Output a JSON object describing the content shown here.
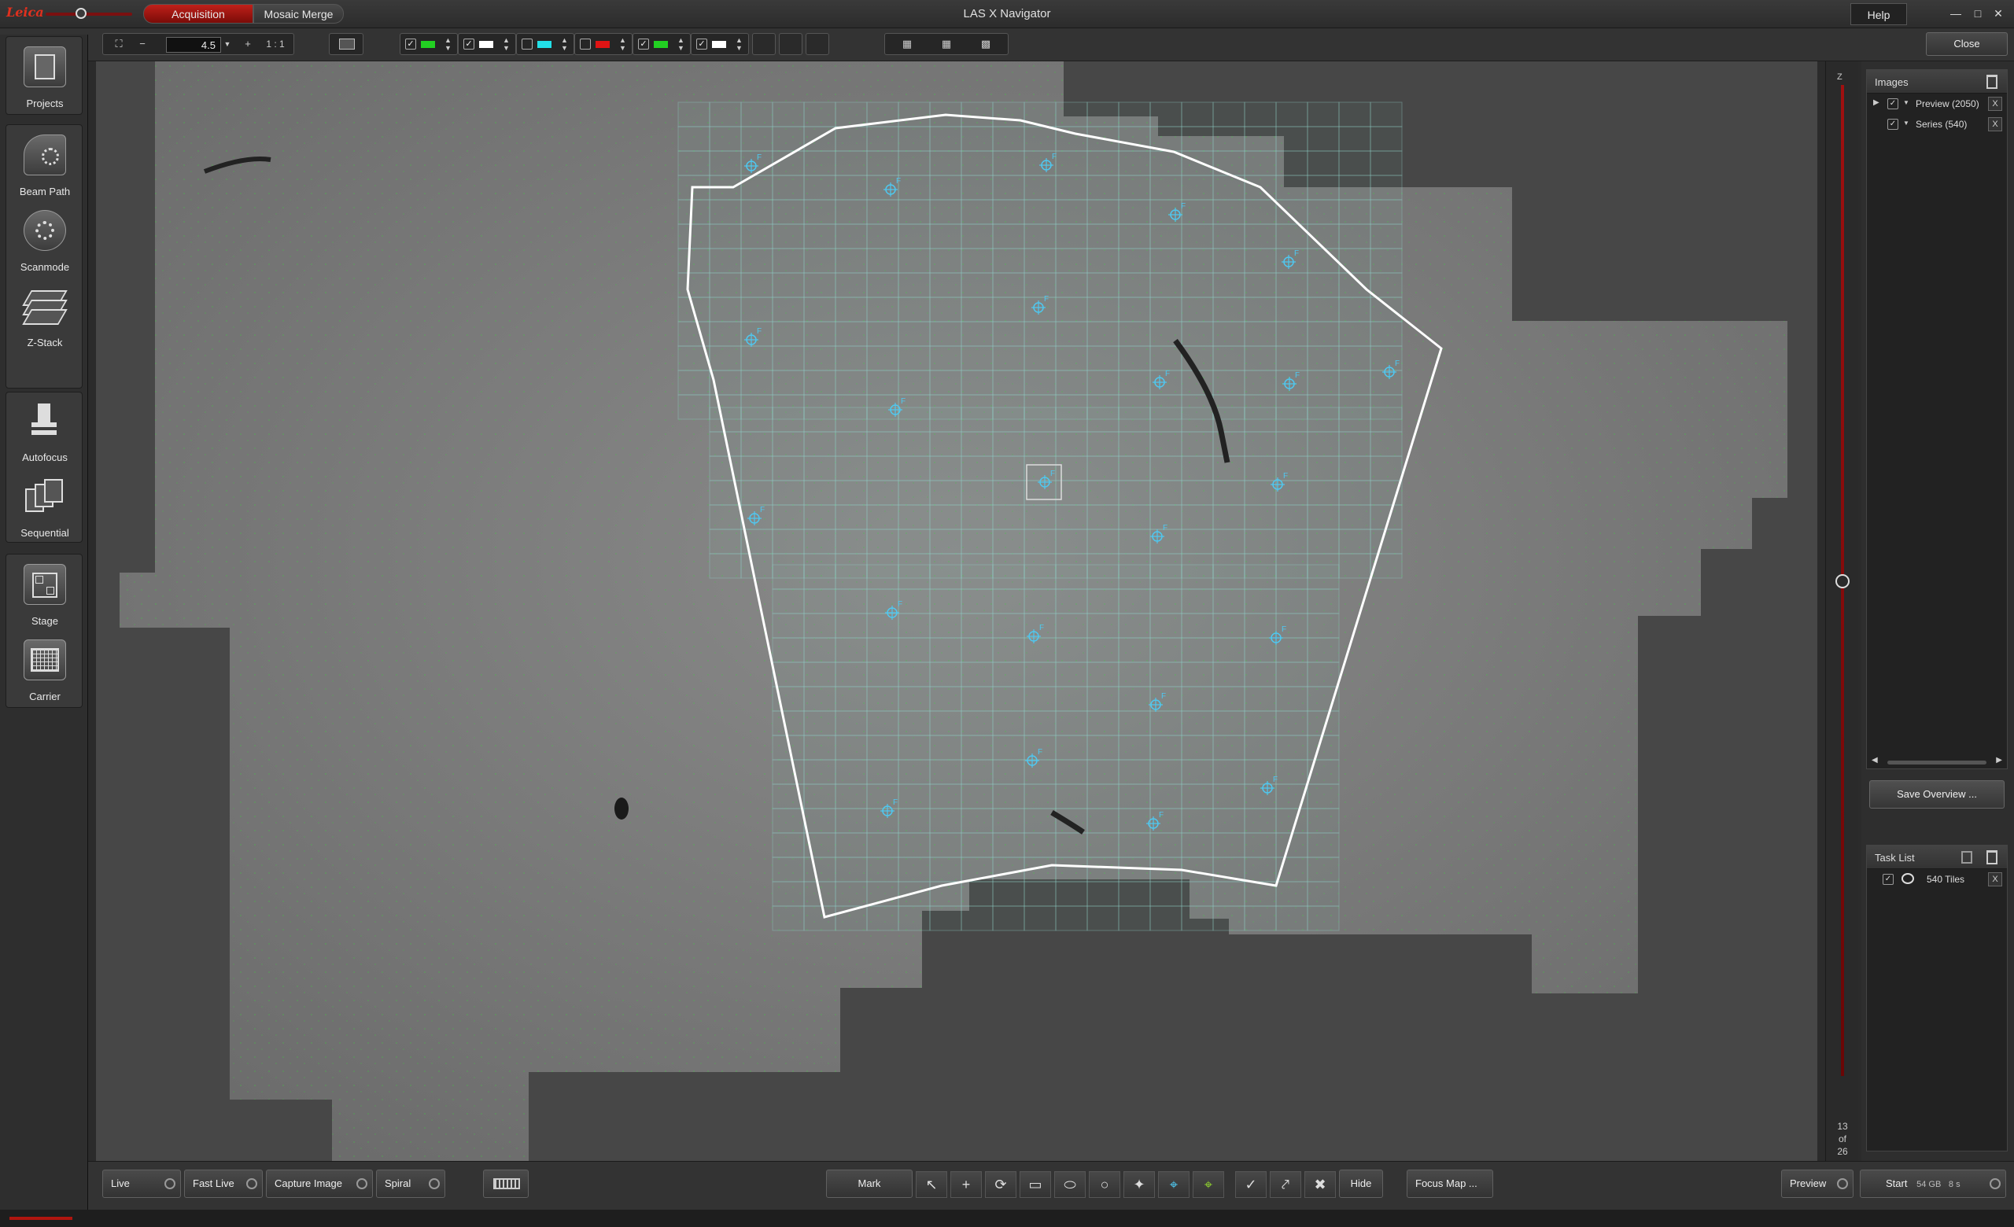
{
  "app": {
    "logo_text": "Leica",
    "title": "LAS X Navigator",
    "help_label": "Help",
    "close_label": "Close",
    "window_controls": [
      "minimize-icon",
      "maximize-icon",
      "close-icon"
    ]
  },
  "mode_tabs": [
    {
      "label": "Acquisition",
      "active": true
    },
    {
      "label": "Mosaic Merge",
      "active": false
    }
  ],
  "toolbar": {
    "zoom_value": "4.5",
    "zoom_out": "−",
    "zoom_in": "+",
    "one_to_one": "1 : 1",
    "channels": [
      {
        "checked": true,
        "color": "#22d022"
      },
      {
        "checked": true,
        "color": "#ffffff"
      },
      {
        "checked": false,
        "color": "#22e0e8"
      },
      {
        "checked": false,
        "color": "#e01414"
      },
      {
        "checked": true,
        "color": "#22d022"
      },
      {
        "checked": true,
        "color": "#ffffff"
      }
    ]
  },
  "sidebar": {
    "items": [
      {
        "label": "Projects",
        "icon": "projects-icon"
      },
      {
        "label": "Beam Path",
        "icon": "beam-path-icon"
      },
      {
        "label": "Scanmode",
        "icon": "scanmode-icon"
      },
      {
        "label": "Z-Stack",
        "icon": "z-stack-icon"
      },
      {
        "label": "Autofocus",
        "icon": "autofocus-icon"
      },
      {
        "label": "Sequential",
        "icon": "sequential-icon"
      },
      {
        "label": "Stage",
        "icon": "stage-icon"
      },
      {
        "label": "Carrier",
        "icon": "carrier-icon"
      }
    ]
  },
  "zslider": {
    "label": "Z",
    "position": "13",
    "of_label": "of",
    "total": "26"
  },
  "images_panel": {
    "title": "Images",
    "items": [
      {
        "label": "Preview (2050)",
        "checked": true,
        "expandable": true
      },
      {
        "label": "Series (540)",
        "checked": true,
        "expandable": false
      }
    ],
    "save_overview_label": "Save Overview ..."
  },
  "task_panel": {
    "title": "Task List",
    "items": [
      {
        "label": "540 Tiles",
        "checked": true
      }
    ]
  },
  "bottom": {
    "live": "Live",
    "fast_live": "Fast Live",
    "capture_image": "Capture Image",
    "spiral": "Spiral",
    "mark": "Mark",
    "hide": "Hide",
    "focus_map": "Focus Map ...",
    "preview": "Preview",
    "start": "Start",
    "start_size": "54 GB",
    "start_time": "8 s"
  },
  "overlay": {
    "accent": "#c0201a",
    "tile_color": "#8fd0c8",
    "marker_color": "#4fc8f0",
    "marker_label": "F"
  }
}
